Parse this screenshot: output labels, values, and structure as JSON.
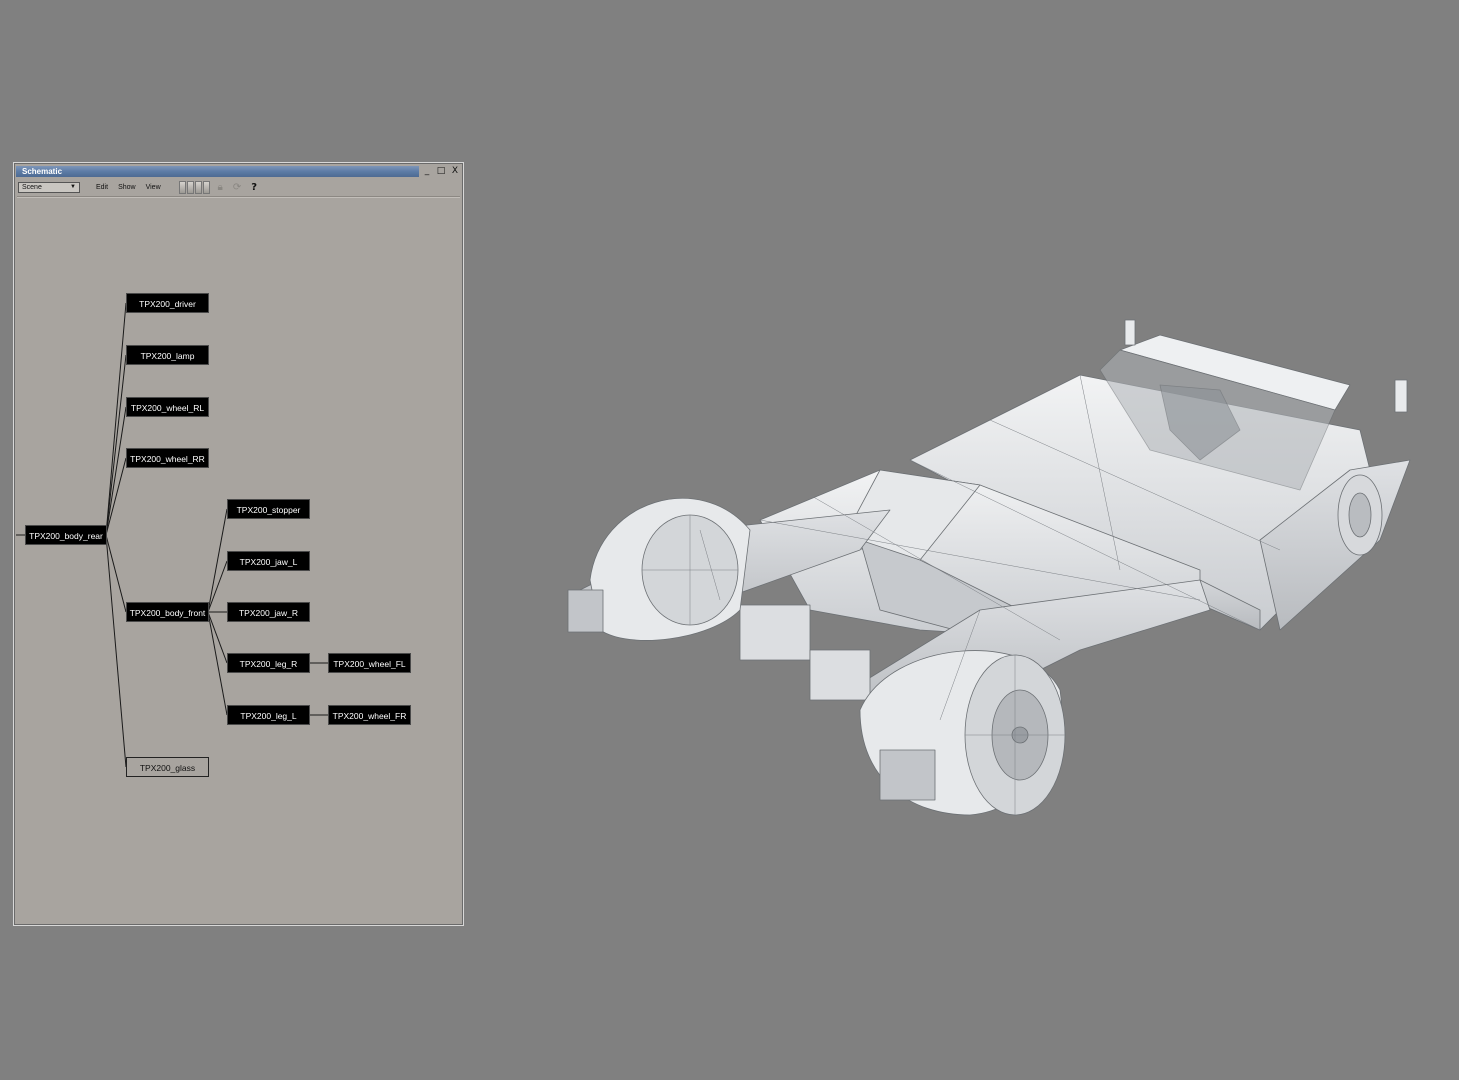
{
  "window": {
    "title": "Schematic",
    "minimize_label": "_",
    "maximize_label": "□",
    "close_label": "X"
  },
  "toolbar": {
    "scene_dropdown": "Scene",
    "menu_edit": "Edit",
    "menu_show": "Show",
    "menu_view": "View",
    "help_label": "?"
  },
  "nodes": {
    "body_rear": "TPX200_body_rear",
    "driver": "TPX200_driver",
    "lamp": "TPX200_lamp",
    "wheel_rl": "TPX200_wheel_RL",
    "wheel_rr": "TPX200_wheel_RR",
    "body_front": "TPX200_body_front",
    "glass": "TPX200_glass",
    "stopper": "TPX200_stopper",
    "jaw_l": "TPX200_jaw_L",
    "jaw_r": "TPX200_jaw_R",
    "leg_r": "TPX200_leg_R",
    "leg_l": "TPX200_leg_L",
    "wheel_fl": "TPX200_wheel_FL",
    "wheel_fr": "TPX200_wheel_FR"
  },
  "viewport": {
    "background_color": "#808080",
    "model_color": "#e4e6e8",
    "wire_color": "#6c7074"
  }
}
